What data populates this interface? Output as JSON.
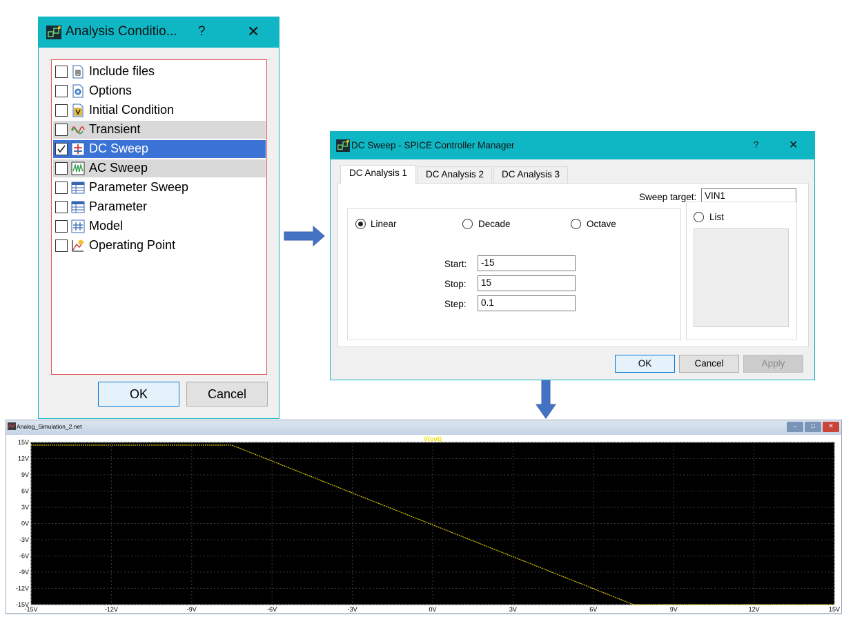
{
  "analysis_dialog": {
    "title": "Analysis Conditio...",
    "help": "?",
    "close": "✕",
    "items": [
      {
        "label": "Include files",
        "checked": false,
        "icon": "include-files-icon",
        "state": "normal"
      },
      {
        "label": "Options",
        "checked": false,
        "icon": "options-gear-icon",
        "state": "normal"
      },
      {
        "label": "Initial Condition",
        "checked": false,
        "icon": "initial-condition-icon",
        "state": "normal"
      },
      {
        "label": "Transient",
        "checked": false,
        "icon": "transient-wave-icon",
        "state": "highlighted"
      },
      {
        "label": "DC Sweep",
        "checked": true,
        "icon": "dc-sweep-icon",
        "state": "selected"
      },
      {
        "label": "AC Sweep",
        "checked": false,
        "icon": "ac-sweep-icon",
        "state": "highlighted"
      },
      {
        "label": "Parameter Sweep",
        "checked": false,
        "icon": "parameter-sweep-icon",
        "state": "normal"
      },
      {
        "label": "Parameter",
        "checked": false,
        "icon": "parameter-icon",
        "state": "normal"
      },
      {
        "label": "Model",
        "checked": false,
        "icon": "model-icon",
        "state": "normal"
      },
      {
        "label": "Operating Point",
        "checked": false,
        "icon": "operating-point-icon",
        "state": "normal"
      }
    ],
    "ok_label": "OK",
    "cancel_label": "Cancel"
  },
  "dc_dialog": {
    "title": "DC Sweep - SPICE Controller Manager",
    "help": "?",
    "close": "✕",
    "tabs": [
      "DC Analysis 1",
      "DC Analysis 2",
      "DC Analysis 3"
    ],
    "active_tab": 0,
    "sweep_target_label": "Sweep target:",
    "sweep_target_value": "VIN1",
    "radios": {
      "linear": "Linear",
      "decade": "Decade",
      "octave": "Octave",
      "list": "List"
    },
    "selected_mode": "Linear",
    "start_label": "Start:",
    "start_value": "-15",
    "stop_label": "Stop:",
    "stop_value": "15",
    "step_label": "Step:",
    "step_value": "0.1",
    "ok_label": "OK",
    "cancel_label": "Cancel",
    "apply_label": "Apply"
  },
  "waveform_window": {
    "title": "Analog_Simulation_2.net",
    "minimize": "–",
    "maximize": "□",
    "close": "✕"
  },
  "colors": {
    "title_bar_teal": "#0fb7c4",
    "selection_blue": "#3a72d6",
    "arrow_blue": "#4472c4",
    "trace_yellow": "#f0e000",
    "plot_background": "#000000"
  },
  "chart_data": {
    "type": "line",
    "title": "V(out)",
    "x_ticks": [
      "-15V",
      "-12V",
      "-9V",
      "-6V",
      "-3V",
      "0V",
      "3V",
      "6V",
      "9V",
      "12V",
      "15V"
    ],
    "y_ticks": [
      "15V",
      "12V",
      "9V",
      "6V",
      "3V",
      "0V",
      "-3V",
      "-6V",
      "-9V",
      "-12V",
      "-15V"
    ],
    "xlim": [
      -15,
      15
    ],
    "ylim": [
      -15,
      15
    ],
    "grid": true,
    "series": [
      {
        "name": "V(out)",
        "x": [
          -15,
          -7.5,
          7.5,
          15
        ],
        "y": [
          14.5,
          14.5,
          -15,
          -15
        ]
      }
    ]
  }
}
